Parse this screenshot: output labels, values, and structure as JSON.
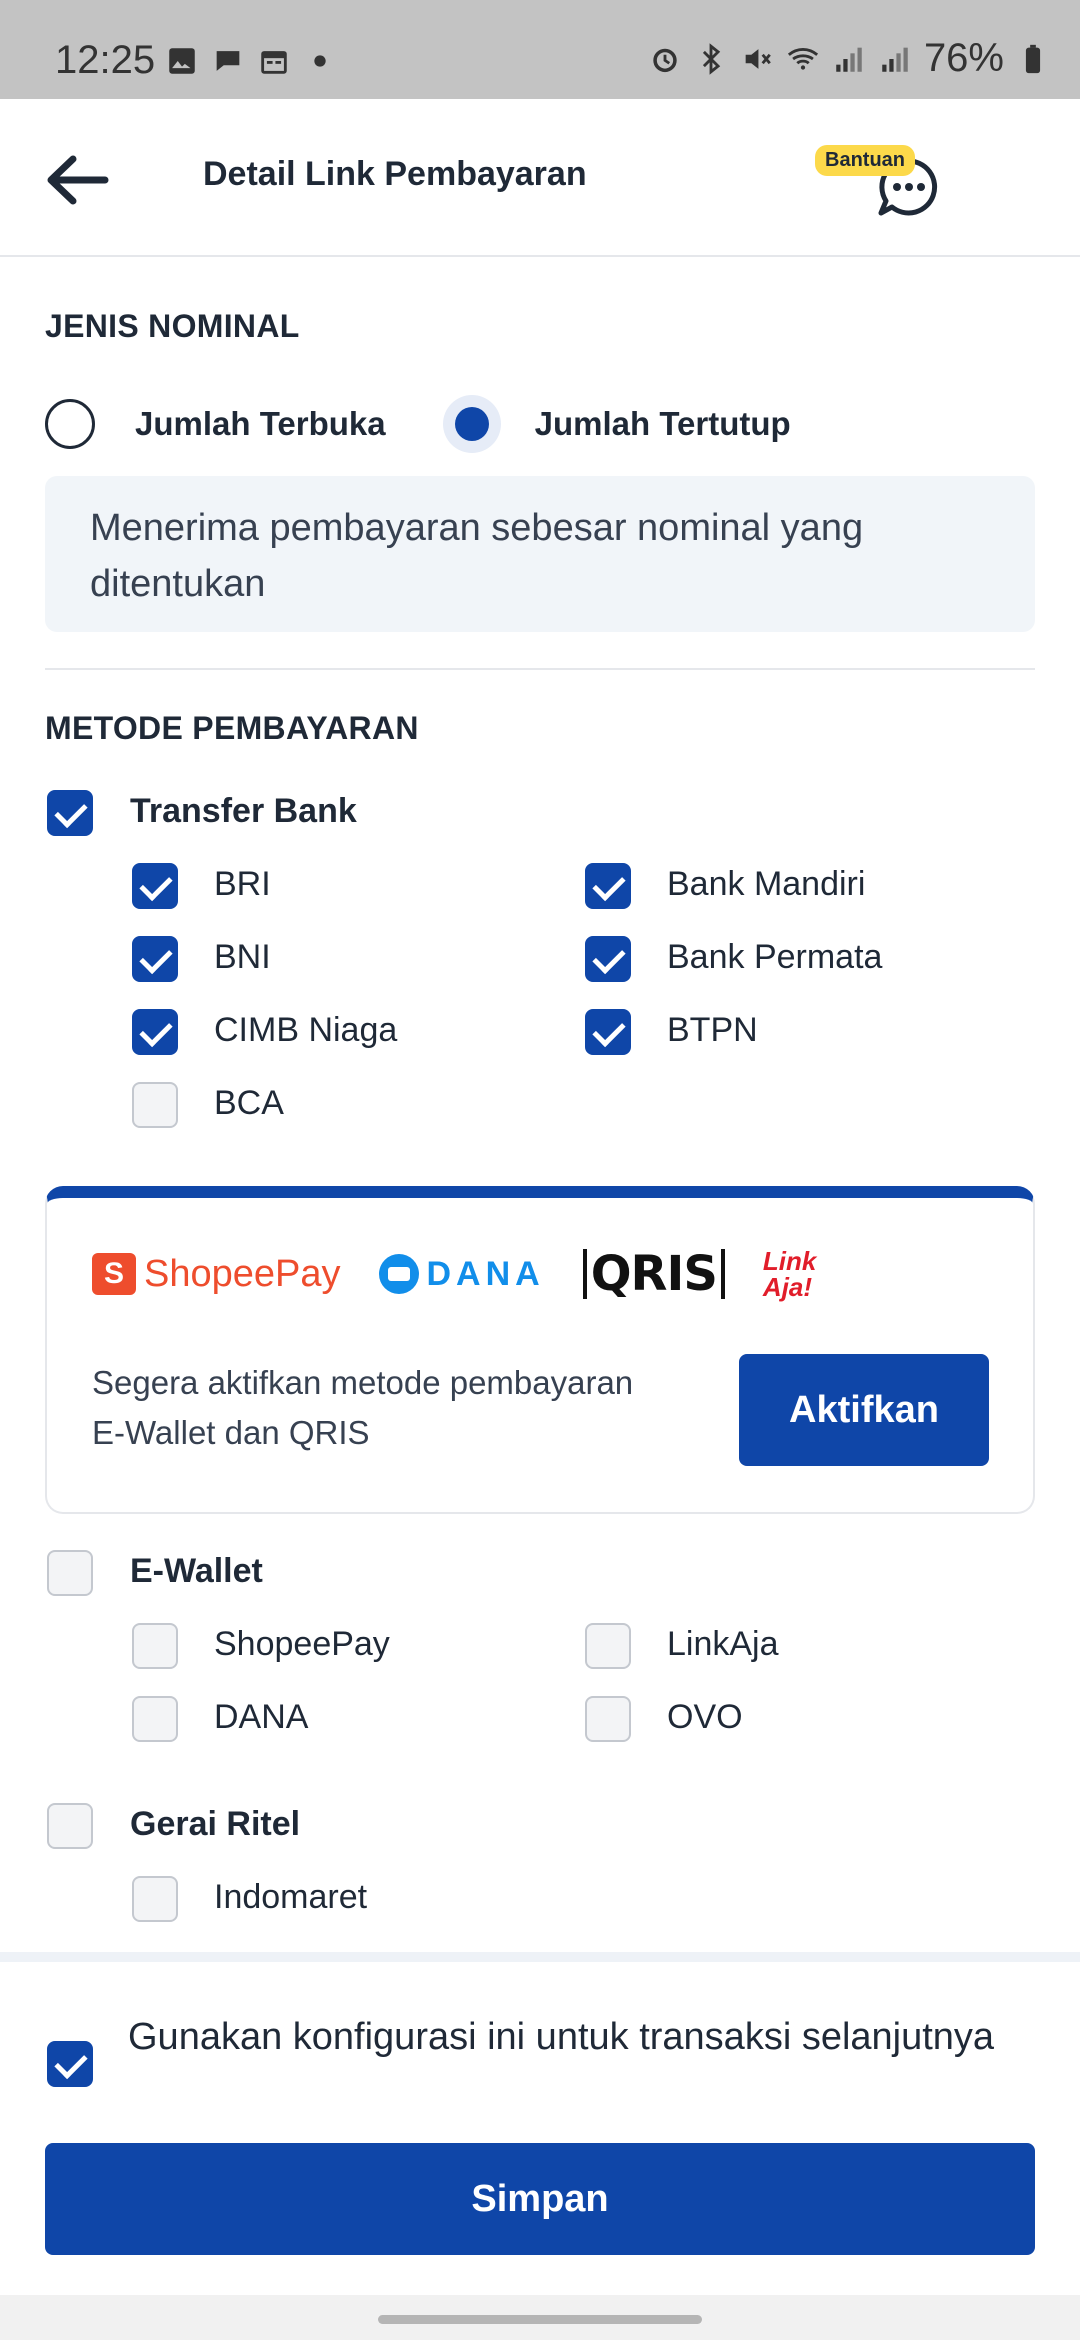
{
  "status_bar": {
    "time": "12:25",
    "battery": "76%",
    "left_icons": [
      "image-icon",
      "chat-bubble-icon",
      "calendar-icon",
      "dot-icon"
    ],
    "right_icons": [
      "alarm-icon",
      "bluetooth-icon",
      "mute-icon",
      "wifi-icon",
      "signal-icon",
      "signal-icon",
      "battery-icon"
    ]
  },
  "header": {
    "title": "Detail Link Pembayaran",
    "help_badge": "Bantuan"
  },
  "nominal": {
    "section_title": "JENIS NOMINAL",
    "options": [
      {
        "label": "Jumlah Terbuka",
        "selected": false
      },
      {
        "label": "Jumlah Tertutup",
        "selected": true
      }
    ],
    "description": "Menerima pembayaran sebesar nominal yang ditentukan"
  },
  "payment_methods": {
    "section_title": "METODE PEMBAYARAN",
    "transfer_bank": {
      "label": "Transfer Bank",
      "checked": true,
      "banks": [
        {
          "label": "BRI",
          "checked": true
        },
        {
          "label": "Bank Mandiri",
          "checked": true
        },
        {
          "label": "BNI",
          "checked": true
        },
        {
          "label": "Bank Permata",
          "checked": true
        },
        {
          "label": "CIMB Niaga",
          "checked": true
        },
        {
          "label": "BTPN",
          "checked": true
        },
        {
          "label": "BCA",
          "checked": false
        }
      ]
    },
    "promo": {
      "logos": [
        "ShopeePay",
        "DANA",
        "QRIS",
        "Link Aja!"
      ],
      "text": "Segera aktifkan metode pembayaran E-Wallet dan QRIS",
      "button": "Aktifkan"
    },
    "ewallet": {
      "label": "E-Wallet",
      "checked": false,
      "items": [
        {
          "label": "ShopeePay",
          "checked": false
        },
        {
          "label": "LinkAja",
          "checked": false
        },
        {
          "label": "DANA",
          "checked": false
        },
        {
          "label": "OVO",
          "checked": false
        }
      ]
    },
    "retail": {
      "label": "Gerai Ritel",
      "checked": false,
      "items": [
        {
          "label": "Indomaret",
          "checked": false
        }
      ]
    }
  },
  "footer": {
    "save_config_label": "Gunakan konfigurasi ini untuk transaksi selanjutnya",
    "save_config_checked": true,
    "save_button": "Simpan"
  },
  "colors": {
    "primary": "#0f46a8",
    "status_bar_bg": "#c3c3c3",
    "badge": "#fcd94a"
  }
}
